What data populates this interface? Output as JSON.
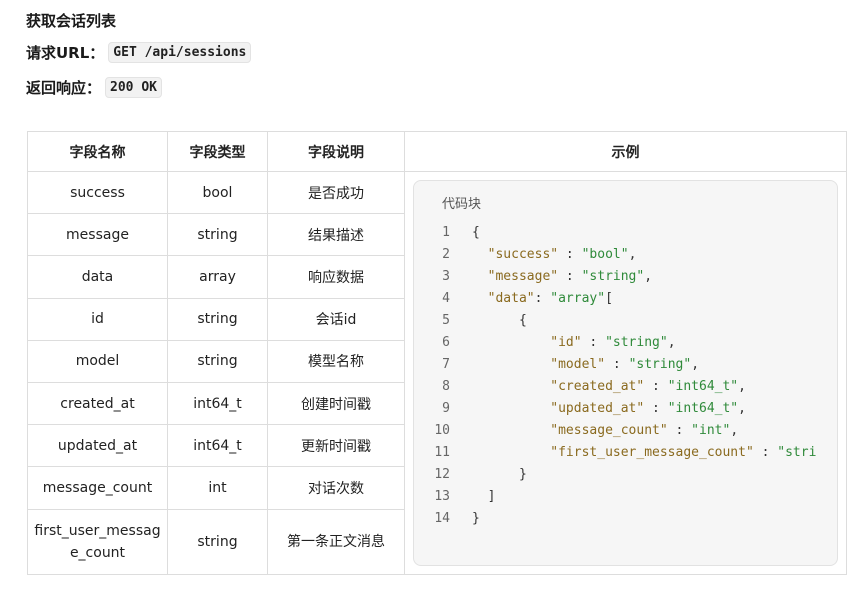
{
  "page": {
    "title": "获取会话列表",
    "request_label": "请求URL：",
    "request_value": "GET /api/sessions",
    "response_label": "返回响应：",
    "response_value": "200 OK"
  },
  "table": {
    "headers": [
      "字段名称",
      "字段类型",
      "字段说明",
      "示例"
    ],
    "rows": [
      {
        "name": "success",
        "type": "bool",
        "desc": "是否成功"
      },
      {
        "name": "message",
        "type": "string",
        "desc": "结果描述"
      },
      {
        "name": "data",
        "type": "array",
        "desc": "响应数据"
      },
      {
        "name": "id",
        "type": "string",
        "desc": "会话id"
      },
      {
        "name": "model",
        "type": "string",
        "desc": "模型名称"
      },
      {
        "name": "created_at",
        "type": "int64_t",
        "desc": "创建时间戳"
      },
      {
        "name": "updated_at",
        "type": "int64_t",
        "desc": "更新时间戳"
      },
      {
        "name": "message_count",
        "type": "int",
        "desc": "对话次数"
      },
      {
        "name": "first_user_message_count",
        "type": "string",
        "desc": "第一条正文消息"
      }
    ]
  },
  "code_block": {
    "label": "代码块",
    "lines": [
      {
        "n": "1",
        "indent": 0,
        "tokens": [
          [
            "punc",
            "{"
          ]
        ]
      },
      {
        "n": "2",
        "indent": 2,
        "tokens": [
          [
            "key",
            "\"success\""
          ],
          [
            "punc",
            " : "
          ],
          [
            "str",
            "\"bool\""
          ],
          [
            "punc",
            ","
          ]
        ]
      },
      {
        "n": "3",
        "indent": 2,
        "tokens": [
          [
            "key",
            "\"message\""
          ],
          [
            "punc",
            " : "
          ],
          [
            "str",
            "\"string\""
          ],
          [
            "punc",
            ","
          ]
        ]
      },
      {
        "n": "4",
        "indent": 2,
        "tokens": [
          [
            "key",
            "\"data\""
          ],
          [
            "punc",
            ": "
          ],
          [
            "str",
            "\"array\""
          ],
          [
            "punc",
            "["
          ]
        ]
      },
      {
        "n": "5",
        "indent": 6,
        "tokens": [
          [
            "punc",
            "{"
          ]
        ]
      },
      {
        "n": "6",
        "indent": 10,
        "tokens": [
          [
            "key",
            "\"id\""
          ],
          [
            "punc",
            " : "
          ],
          [
            "str",
            "\"string\""
          ],
          [
            "punc",
            ","
          ]
        ]
      },
      {
        "n": "7",
        "indent": 10,
        "tokens": [
          [
            "key",
            "\"model\""
          ],
          [
            "punc",
            " : "
          ],
          [
            "str",
            "\"string\""
          ],
          [
            "punc",
            ","
          ]
        ]
      },
      {
        "n": "8",
        "indent": 10,
        "tokens": [
          [
            "key",
            "\"created_at\""
          ],
          [
            "punc",
            " : "
          ],
          [
            "str",
            "\"int64_t\""
          ],
          [
            "punc",
            ","
          ]
        ]
      },
      {
        "n": "9",
        "indent": 10,
        "tokens": [
          [
            "key",
            "\"updated_at\""
          ],
          [
            "punc",
            " : "
          ],
          [
            "str",
            "\"int64_t\""
          ],
          [
            "punc",
            ","
          ]
        ]
      },
      {
        "n": "10",
        "indent": 10,
        "tokens": [
          [
            "key",
            "\"message_count\""
          ],
          [
            "punc",
            " : "
          ],
          [
            "str",
            "\"int\""
          ],
          [
            "punc",
            ","
          ]
        ]
      },
      {
        "n": "11",
        "indent": 10,
        "tokens": [
          [
            "key",
            "\"first_user_message_count\""
          ],
          [
            "punc",
            " : "
          ],
          [
            "str",
            "\"stri"
          ]
        ]
      },
      {
        "n": "12",
        "indent": 6,
        "tokens": [
          [
            "punc",
            "}"
          ]
        ]
      },
      {
        "n": "13",
        "indent": 2,
        "tokens": [
          [
            "punc",
            "]"
          ]
        ]
      },
      {
        "n": "14",
        "indent": 0,
        "tokens": [
          [
            "punc",
            "}"
          ]
        ]
      }
    ]
  }
}
